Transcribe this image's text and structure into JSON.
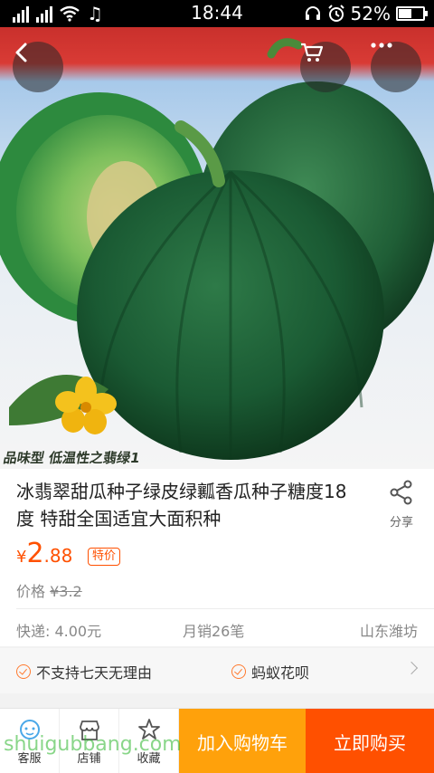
{
  "status_bar": {
    "time": "18:44",
    "battery": "52%",
    "battery_level": 0.52
  },
  "product": {
    "title": "冰翡翠甜瓜种子绿皮绿瓤香瓜种子糖度18度 特甜全国适宜大面积种",
    "image_caption": "品味型 低温性之翡绿1",
    "price_symbol": "¥",
    "price_int": "2",
    "price_dec": ".88",
    "price_tag": "特价",
    "orig_label": "价格",
    "orig_price": "¥3.2",
    "shipping": "快递: 4.00元",
    "monthly_sales": "月销26笔",
    "location": "山东潍坊"
  },
  "share_label": "分享",
  "services": {
    "item1": "不支持七天无理由",
    "item2": "蚂蚁花呗"
  },
  "bottom_bar": {
    "service_label": "客服",
    "shop_label": "店铺",
    "fav_label": "收藏",
    "cart_label": "加入购物车",
    "buy_label": "立即购买"
  },
  "watermark": "shuigubbang.com",
  "colors": {
    "accent": "#ff5000",
    "cart": "#ffa10b"
  },
  "icons": [
    "back-arrow-icon",
    "cart-icon",
    "more-icon",
    "share-icon",
    "check-circle-icon",
    "chevron-right-icon",
    "customer-service-icon",
    "shop-icon",
    "star-icon"
  ]
}
